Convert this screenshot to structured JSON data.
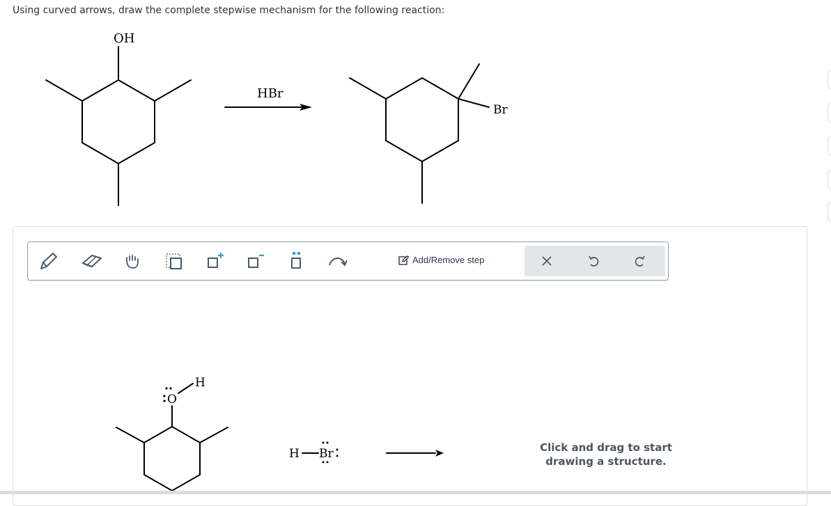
{
  "question": {
    "prompt": "Using curved arrows, draw the complete stepwise mechanism for the following reaction:"
  },
  "reaction": {
    "reactant_label": "OH",
    "reagent_label": "HBr",
    "product_label": "Br"
  },
  "toolbar": {
    "add_remove_label": "Add/Remove step",
    "tools": [
      "pencil-icon",
      "eraser-icon",
      "hand-icon",
      "selection-icon",
      "positive-charge-icon",
      "negative-charge-icon",
      "lone-pair-icon",
      "curved-arrow-icon"
    ],
    "actions": [
      "clear-icon",
      "undo-icon",
      "redo-icon"
    ],
    "accent_color": "#2aa3c8"
  },
  "canvas": {
    "oxygen_label": "O",
    "hydrogen_label": "H",
    "hbr_h_label": "H",
    "hbr_br_label": "Br",
    "hint_line1": "Click and drag to start",
    "hint_line2": "drawing a structure."
  }
}
